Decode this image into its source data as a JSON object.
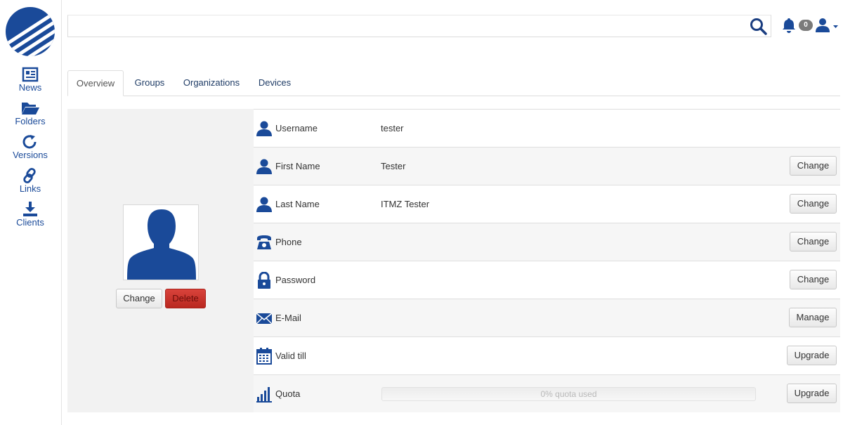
{
  "colors": {
    "brand": "#1a4a99",
    "danger": "#c9302c"
  },
  "sidebar": {
    "logo_icon": "globe-logo",
    "items": [
      {
        "label": "News",
        "icon": "newspaper-icon"
      },
      {
        "label": "Folders",
        "icon": "folder-open-icon"
      },
      {
        "label": "Versions",
        "icon": "refresh-icon"
      },
      {
        "label": "Links",
        "icon": "link-icon"
      },
      {
        "label": "Clients",
        "icon": "download-icon"
      }
    ]
  },
  "topbar": {
    "search_value": "",
    "notification_count": "0"
  },
  "tabs": [
    {
      "label": "Overview",
      "active": true
    },
    {
      "label": "Groups",
      "active": false
    },
    {
      "label": "Organizations",
      "active": false
    },
    {
      "label": "Devices",
      "active": false
    }
  ],
  "avatar": {
    "change_label": "Change",
    "delete_label": "Delete"
  },
  "fields": [
    {
      "label": "Username",
      "value": "tester",
      "icon": "user-icon",
      "action": ""
    },
    {
      "label": "First Name",
      "value": "Tester",
      "icon": "user-icon",
      "action": "Change"
    },
    {
      "label": "Last Name",
      "value": "ITMZ Tester",
      "icon": "user-icon",
      "action": "Change"
    },
    {
      "label": "Phone",
      "value": "",
      "icon": "phone-icon",
      "action": "Change"
    },
    {
      "label": "Password",
      "value": "",
      "icon": "lock-icon",
      "action": "Change"
    },
    {
      "label": "E-Mail",
      "value": "",
      "icon": "envelope-icon",
      "action": "Manage"
    },
    {
      "label": "Valid till",
      "value": "",
      "icon": "calendar-icon",
      "action": "Upgrade"
    },
    {
      "label": "Quota",
      "value": "",
      "icon": "bar-chart-icon",
      "action": "Upgrade"
    }
  ],
  "quota": {
    "text": "0% quota used",
    "percent": 0
  }
}
